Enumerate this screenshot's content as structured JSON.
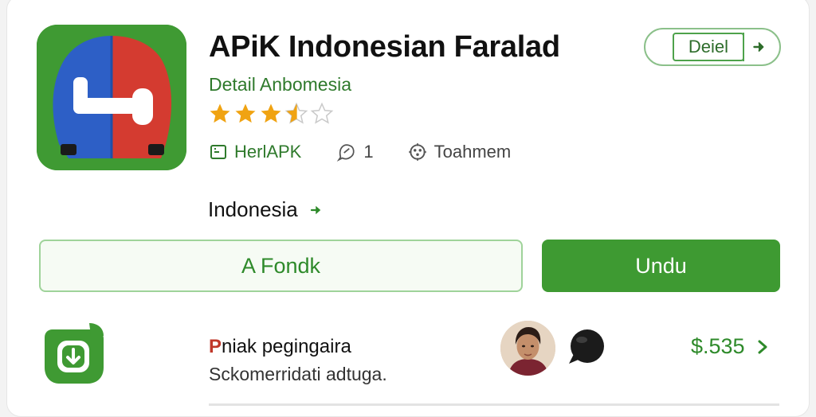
{
  "app": {
    "title": "APiK Indonesian Faralad",
    "subtitle": "Detail Anbomesia",
    "rating_value": 3.5,
    "rating_max": 5
  },
  "meta": {
    "publisher": "HerlAPK",
    "count": "1",
    "category": "Toahmem"
  },
  "detail_button": {
    "label": "Deiel"
  },
  "section": {
    "label": "Indonesia"
  },
  "actions": {
    "secondary_label": "A Fondk",
    "primary_label": "Undu"
  },
  "promo": {
    "title_mark": "P",
    "title_rest": "niak pegingaira",
    "description": "Sckomerridati adtuga.",
    "price": "$.535"
  },
  "icons": {
    "app": "app-logo-icon",
    "publisher": "developer-badge-icon",
    "comments": "comment-icon",
    "category": "category-icon",
    "detail_arrow": "chevron-right-icon",
    "download": "download-icon",
    "chat": "chat-bubble-icon"
  },
  "colors": {
    "accent": "#3e9a32",
    "accent_dark": "#2e8a2a",
    "star": "#f0a312",
    "icon_red": "#d63b30",
    "icon_blue": "#2d63c8"
  }
}
